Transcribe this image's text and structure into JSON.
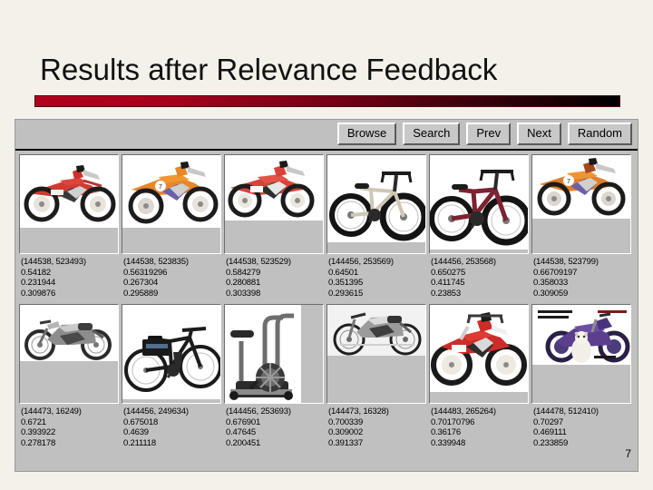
{
  "slide": {
    "title": "Results after Relevance Feedback",
    "accent_color_start": "#b2001f",
    "accent_color_end": "#000000",
    "page_number": "7"
  },
  "toolbar": {
    "buttons": [
      {
        "label": "Browse",
        "name": "browse-button"
      },
      {
        "label": "Search",
        "name": "search-button"
      },
      {
        "label": "Prev",
        "name": "prev-button"
      },
      {
        "label": "Next",
        "name": "next-button"
      },
      {
        "label": "Random",
        "name": "random-button"
      }
    ]
  },
  "results": {
    "rows": [
      {
        "cells": [
          {
            "id": "(144538, 523493)",
            "v1": "0.54182",
            "v2": "0.231944",
            "v3": "0.309876",
            "image": "red-dirt-bike"
          },
          {
            "id": "(144538, 523835)",
            "v1": "0.56319296",
            "v2": "0.267304",
            "v3": "0.295889",
            "image": "orange-dirt-bike"
          },
          {
            "id": "(144538, 523529)",
            "v1": "0.584279",
            "v2": "0.280881",
            "v3": "0.303398",
            "image": "red-white-dirt-bike"
          },
          {
            "id": "(144456, 253569)",
            "v1": "0.64501",
            "v2": "0.351395",
            "v3": "0.293615",
            "image": "tan-bmx-bicycle"
          },
          {
            "id": "(144456, 253568)",
            "v1": "0.650275",
            "v2": "0.411745",
            "v3": "0.23853",
            "image": "dark-red-bmx-bicycle"
          },
          {
            "id": "(144538, 523799)",
            "v1": "0.66709197",
            "v2": "0.358033",
            "v3": "0.309059",
            "image": "orange-motocross-bike"
          }
        ]
      },
      {
        "cells": [
          {
            "id": "(144473, 16249)",
            "v1": "0.6721",
            "v2": "0.393922",
            "v3": "0.278178",
            "image": "vintage-motorcycle-bw"
          },
          {
            "id": "(144456, 249634)",
            "v1": "0.675018",
            "v2": "0.4639",
            "v3": "0.211118",
            "image": "black-touring-bicycle"
          },
          {
            "id": "(144456, 253693)",
            "v1": "0.676901",
            "v2": "0.47645",
            "v3": "0.200451",
            "image": "exercise-bike"
          },
          {
            "id": "(144473, 16328)",
            "v1": "0.700339",
            "v2": "0.309002",
            "v3": "0.391337",
            "image": "classic-motorcycle-bw"
          },
          {
            "id": "(144483, 265264)",
            "v1": "0.70170796",
            "v2": "0.36176",
            "v3": "0.339948",
            "image": "red-enduro-bike"
          },
          {
            "id": "(144478, 512410)",
            "v1": "0.70297",
            "v2": "0.469111",
            "v3": "0.233859",
            "image": "purple-chopper-poster"
          }
        ]
      }
    ]
  }
}
